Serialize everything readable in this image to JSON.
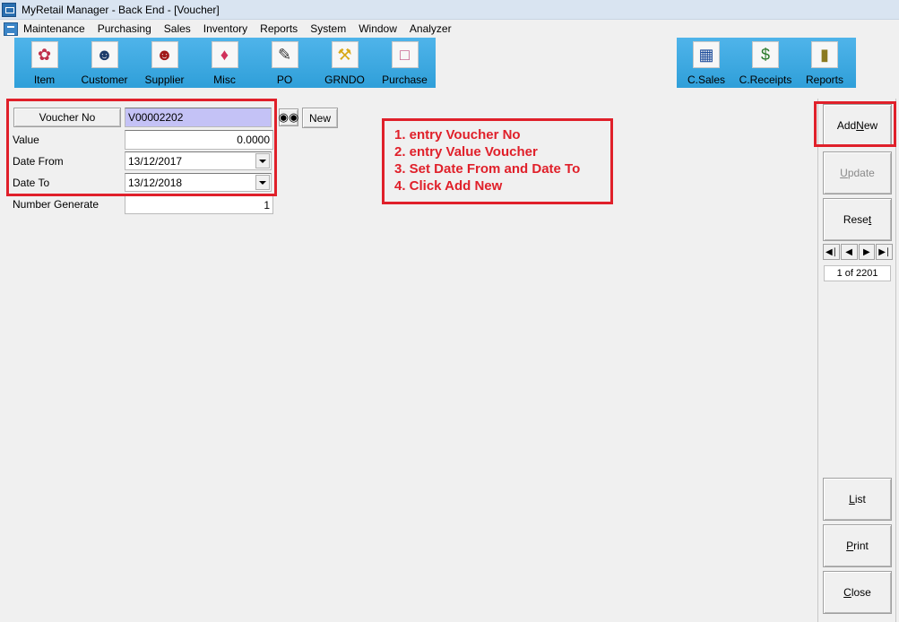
{
  "window": {
    "title": "MyRetail Manager - Back End - [Voucher]"
  },
  "menu": [
    "Maintenance",
    "Purchasing",
    "Sales",
    "Inventory",
    "Reports",
    "System",
    "Window",
    "Analyzer"
  ],
  "toolbar": {
    "left": [
      {
        "label": "Item",
        "icon": "item-icon"
      },
      {
        "label": "Customer",
        "icon": "customer-icon"
      },
      {
        "label": "Supplier",
        "icon": "supplier-icon"
      },
      {
        "label": "Misc",
        "icon": "misc-icon"
      },
      {
        "label": "PO",
        "icon": "po-icon"
      },
      {
        "label": "GRNDO",
        "icon": "grndo-icon"
      },
      {
        "label": "Purchase",
        "icon": "purchase-icon"
      }
    ],
    "right": [
      {
        "label": "C.Sales",
        "icon": "cash-register-icon"
      },
      {
        "label": "C.Receipts",
        "icon": "money-bag-icon"
      },
      {
        "label": "Reports",
        "icon": "reports-book-icon"
      }
    ]
  },
  "form": {
    "voucher_no_button": "Voucher No",
    "voucher_no_value": "V00002202",
    "new_button": "New",
    "value_label": "Value",
    "value_value": "0.0000",
    "date_from_label": "Date From",
    "date_from_value": "13/12/2017",
    "date_to_label": "Date To",
    "date_to_value": "13/12/2018",
    "number_generate_label": "Number Generate",
    "number_generate_value": "1"
  },
  "instructions": [
    "1. entry Voucher No",
    "2. entry Value Voucher",
    "3. Set Date From and Date To",
    "4. Click Add New"
  ],
  "actions": {
    "add_new_pre": "Add ",
    "add_new_u": "N",
    "add_new_post": "ew",
    "update_u": "U",
    "update_post": "pdate",
    "reset_pre": "Rese",
    "reset_u": "t",
    "list_u": "L",
    "list_post": "ist",
    "print_u": "P",
    "print_post": "rint",
    "close_u": "C",
    "close_post": "lose"
  },
  "navigation": {
    "counter": "1 of 2201"
  },
  "colors": {
    "annotation_red": "#e0202a",
    "toolbar_blue": "#3aa8e0",
    "selected_input": "#c4c2f6"
  }
}
